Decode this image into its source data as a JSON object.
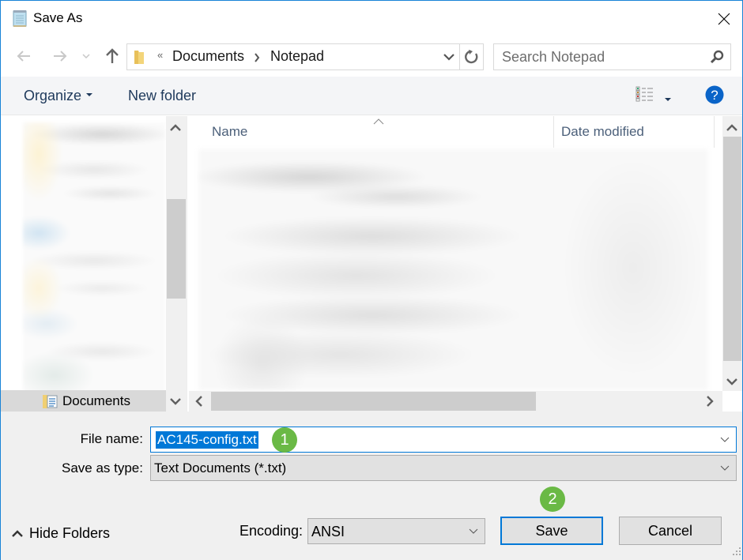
{
  "window": {
    "title": "Save As",
    "icon": "notepad-icon",
    "close_icon": "close-icon"
  },
  "nav": {
    "back_icon": "arrow-left-icon",
    "forward_icon": "arrow-right-icon",
    "recent_icon": "chevron-down-icon",
    "up_icon": "arrow-up-icon",
    "address": {
      "overflow_glyph": "«",
      "crumbs": [
        "Documents",
        "Notepad"
      ],
      "dropdown_icon": "chevron-down-icon",
      "refresh_icon": "refresh-icon"
    },
    "search": {
      "placeholder": "Search Notepad",
      "value": "",
      "icon": "search-icon"
    }
  },
  "toolbar": {
    "organize_label": "Organize",
    "new_folder_label": "New folder",
    "view_icon": "view-details-icon",
    "help_icon": "help-icon",
    "help_glyph": "?"
  },
  "nav_pane": {
    "visible_item": "Documents",
    "note": "other items blurred"
  },
  "file_list": {
    "columns": [
      "Name",
      "Date modified"
    ],
    "sort_column": "Name",
    "sort_glyph": "^"
  },
  "form": {
    "file_name_label": "File name:",
    "file_name_value": "AC145-config.txt",
    "save_as_type_label": "Save as type:",
    "save_as_type_value": "Text Documents (*.txt)",
    "encoding_label": "Encoding:",
    "encoding_value": "ANSI"
  },
  "buttons": {
    "hide_folders": "Hide Folders",
    "save": "Save",
    "cancel": "Cancel"
  },
  "annotations": {
    "step1": "1",
    "step2": "2",
    "badge_color": "#6ab945"
  },
  "colors": {
    "accent": "#0078d7",
    "header_text": "#4c607a",
    "toolbar_text": "#1e395b"
  }
}
